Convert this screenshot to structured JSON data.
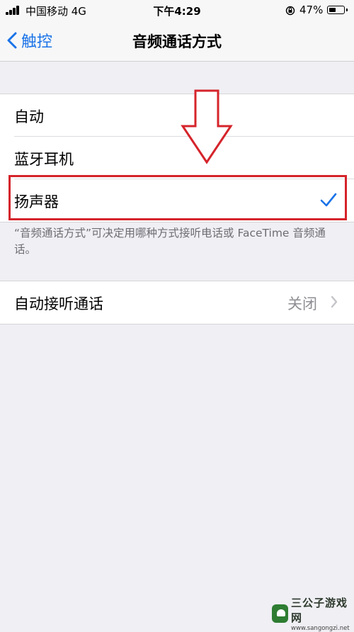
{
  "status": {
    "carrier": "中国移动 4G",
    "time": "下午4:29",
    "battery_pct": "47%"
  },
  "nav": {
    "back_label": "触控",
    "title": "音频通话方式"
  },
  "options": [
    {
      "label": "自动"
    },
    {
      "label": "蓝牙耳机"
    },
    {
      "label": "扬声器",
      "selected": true
    }
  ],
  "footer_note": "“音频通话方式”可决定用哪种方式接听电话或 FaceTime 音频通话。",
  "auto_answer": {
    "label": "自动接听通话",
    "value": "关闭"
  },
  "colors": {
    "accent": "#1a73e8",
    "highlight": "#d5242b"
  },
  "watermark": {
    "title": "三公子游戏网",
    "url": "www.sangongzi.net"
  }
}
